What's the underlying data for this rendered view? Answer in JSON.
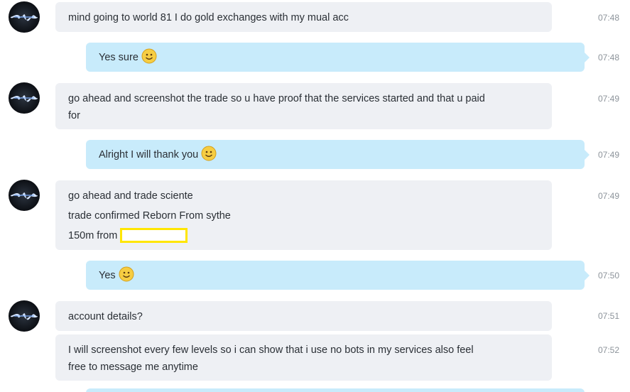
{
  "conversation": {
    "messages": [
      {
        "direction": "in",
        "lines": [
          "mind going to world 81 I do gold exchanges with my mual acc"
        ],
        "time": "07:48"
      },
      {
        "direction": "out",
        "lines": [
          "Yes sure"
        ],
        "emoji": "smile-emoticon",
        "time": "07:48"
      },
      {
        "direction": "in",
        "lines": [
          "go ahead and screenshot the trade so u have proof that the services started and that u paid",
          "for"
        ],
        "time": "07:49"
      },
      {
        "direction": "out",
        "lines": [
          "Alright I will thank you"
        ],
        "emoji": "smile-emoticon",
        "time": "07:49"
      },
      {
        "direction": "in",
        "lines": [
          "go ahead and trade sciente",
          "trade confirmed Reborn From sythe",
          "150m from"
        ],
        "redacted_after_last_line": true,
        "time": "07:49"
      },
      {
        "direction": "out",
        "lines": [
          "Yes"
        ],
        "emoji": "smile-emoticon",
        "time": "07:50"
      },
      {
        "direction": "in",
        "lines": [
          "account details?"
        ],
        "time": "07:51"
      },
      {
        "direction": "in",
        "lines": [
          "I will screenshot every few levels so i can show that i use no bots in my services also feel",
          "free to message me anytime"
        ],
        "time": "07:52"
      }
    ]
  },
  "theme": {
    "incoming_bubble": "#eef0f4",
    "outgoing_bubble": "#c8ebfb",
    "timestamp_color": "#8c939a",
    "redaction_border": "#ffe600",
    "avatar_icon": "dark-wave-avatar-icon"
  }
}
